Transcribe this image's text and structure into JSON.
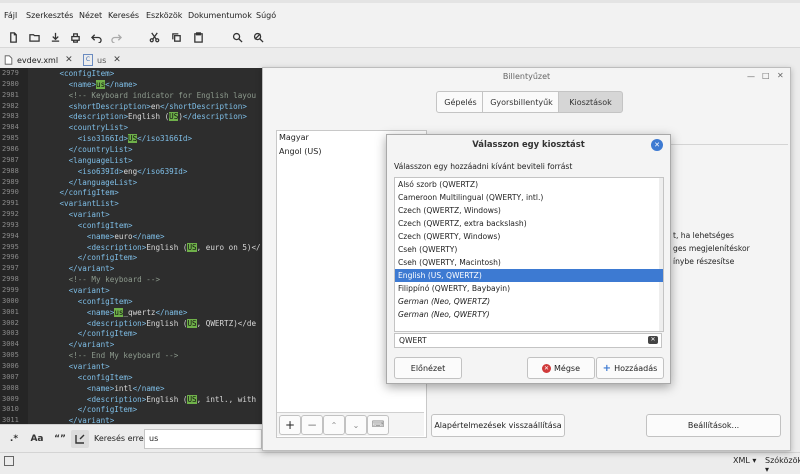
{
  "menubar": {
    "items": [
      "Fájl",
      "Szerkesztés",
      "Nézet",
      "Keresés",
      "Eszközök",
      "Dokumentumok",
      "Súgó"
    ]
  },
  "toolbar": {
    "icons": [
      "new-file-icon",
      "open-icon",
      "save-icon",
      "print-icon",
      "undo-icon",
      "redo-icon",
      "cut-icon",
      "copy-icon",
      "paste-icon",
      "search-icon",
      "replace-icon"
    ]
  },
  "tabs": [
    {
      "label": "evdev.xml",
      "active": true
    },
    {
      "label": "us",
      "active": false
    }
  ],
  "editor": {
    "lines": [
      {
        "n": "2979",
        "text": "      <configItem>"
      },
      {
        "n": "2980",
        "text": "        <name>us</name>"
      },
      {
        "n": "2981",
        "text": "        <!-- Keyboard indicator for English layou"
      },
      {
        "n": "2982",
        "text": "        <shortDescription>en</shortDescription>"
      },
      {
        "n": "2983",
        "text": "        <description>English (US)</description>"
      },
      {
        "n": "2984",
        "text": "        <countryList>"
      },
      {
        "n": "2985",
        "text": "          <iso3166Id>US</iso3166Id>"
      },
      {
        "n": "2986",
        "text": "        </countryList>"
      },
      {
        "n": "2987",
        "text": "        <languageList>"
      },
      {
        "n": "2988",
        "text": "          <iso639Id>eng</iso639Id>"
      },
      {
        "n": "2989",
        "text": "        </languageList>"
      },
      {
        "n": "2990",
        "text": "      </configItem>"
      },
      {
        "n": "2991",
        "text": "      <variantList>"
      },
      {
        "n": "2992",
        "text": "        <variant>"
      },
      {
        "n": "2993",
        "text": "          <configItem>"
      },
      {
        "n": "2994",
        "text": "            <name>euro</name>"
      },
      {
        "n": "2995",
        "text": "            <description>English (US, euro on 5)</"
      },
      {
        "n": "2996",
        "text": "          </configItem>"
      },
      {
        "n": "2997",
        "text": "        </variant>"
      },
      {
        "n": "2998",
        "text": "        <!-- My keyboard -->"
      },
      {
        "n": "2999",
        "text": "        <variant>"
      },
      {
        "n": "3000",
        "text": "          <configItem>"
      },
      {
        "n": "3001",
        "text": "            <name>us_qwertz</name>"
      },
      {
        "n": "3002",
        "text": "            <description>English (US, QWERTZ)</de"
      },
      {
        "n": "3003",
        "text": "          </configItem>"
      },
      {
        "n": "3004",
        "text": "        </variant>"
      },
      {
        "n": "3005",
        "text": "        <!-- End My keyboard -->"
      },
      {
        "n": "3006",
        "text": "        <variant>"
      },
      {
        "n": "3007",
        "text": "          <configItem>"
      },
      {
        "n": "3008",
        "text": "            <name>intl</name>"
      },
      {
        "n": "3009",
        "text": "            <description>English (US, intl., with"
      },
      {
        "n": "3010",
        "text": "          </configItem>"
      },
      {
        "n": "3011",
        "text": "        </variant>"
      },
      {
        "n": "3012",
        "text": "        <variant>"
      }
    ]
  },
  "findbar": {
    "label": "Keresés erre:",
    "value": "us",
    "regex_label": ".*",
    "case_label": "Aa",
    "quote_label": "“”"
  },
  "statusbar": {
    "syntax": "XML",
    "tabs": "Szóközök"
  },
  "keyboard_window": {
    "title": "Billentyűzet",
    "segments": [
      "Gépelés",
      "Gyorsbillentyűk",
      "Kiosztások"
    ],
    "active_segment": "Kiosztások",
    "layouts": [
      "Magyar",
      "Angol (US)"
    ],
    "right_text_1": "t, ha lehetséges",
    "right_text_2": "ges megjelenítéskor",
    "right_text_3": "ínybe részesítse",
    "reset_button": "Alapértelmezések visszaállítása",
    "settings_button": "Beállítások..."
  },
  "modal": {
    "title": "Válasszon egy kiosztást",
    "prompt": "Válasszon egy hozzáadni kívánt beviteli forrást",
    "items": [
      {
        "label": "Alsó szorb (QWERTZ)",
        "selected": false,
        "italic": false
      },
      {
        "label": "Cameroon Multilingual (QWERTY, intl.)",
        "selected": false,
        "italic": false
      },
      {
        "label": "Czech (QWERTZ, Windows)",
        "selected": false,
        "italic": false
      },
      {
        "label": "Czech (QWERTZ, extra backslash)",
        "selected": false,
        "italic": false
      },
      {
        "label": "Czech (QWERTY, Windows)",
        "selected": false,
        "italic": false
      },
      {
        "label": "Cseh (QWERTY)",
        "selected": false,
        "italic": false
      },
      {
        "label": "Cseh (QWERTY, Macintosh)",
        "selected": false,
        "italic": false
      },
      {
        "label": "English (US, QWERTZ)",
        "selected": true,
        "italic": false
      },
      {
        "label": "Filippínó (QWERTY, Baybayin)",
        "selected": false,
        "italic": false
      },
      {
        "label": "German (Neo, QWERTZ)",
        "selected": false,
        "italic": true
      },
      {
        "label": "German (Neo, QWERTY)",
        "selected": false,
        "italic": true
      }
    ],
    "search_value": "QWERT",
    "preview_button": "Előnézet",
    "cancel_button": "Mégse",
    "add_button": "Hozzáadás"
  },
  "colors": {
    "selection": "#3d7ad2",
    "editor_bg": "#2d2d2d",
    "match_highlight": "#6fb04a",
    "tag": "#7fbfe8"
  }
}
